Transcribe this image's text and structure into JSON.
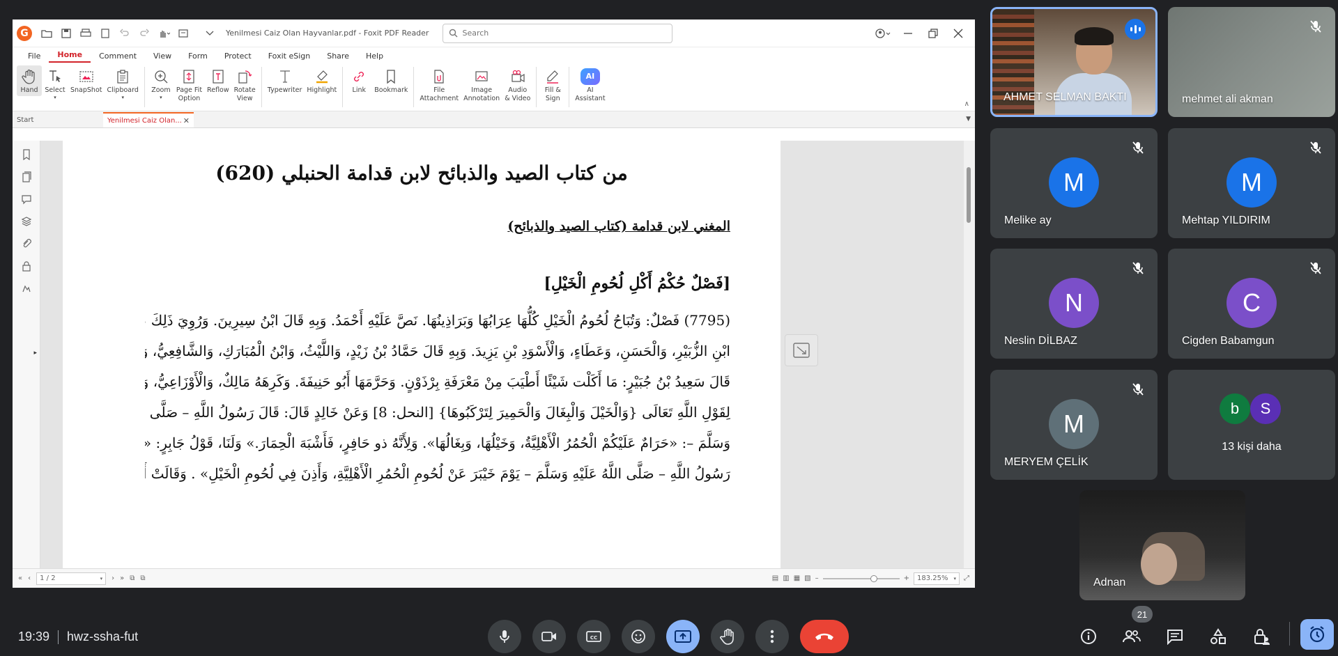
{
  "pdf": {
    "title": "Yenilmesi Caiz Olan Hayvanlar.pdf - Foxit PDF Reader",
    "search_placeholder": "Search",
    "menu": [
      "File",
      "Home",
      "Comment",
      "View",
      "Form",
      "Protect",
      "Foxit eSign",
      "Share",
      "Help"
    ],
    "ribbon": {
      "hand": "Hand",
      "select": "Select",
      "snapshot": "SnapShot",
      "clipboard": "Clipboard",
      "zoom": "Zoom",
      "pagefit_1": "Page Fit",
      "pagefit_2": "Option",
      "reflow": "Reflow",
      "rotate_1": "Rotate",
      "rotate_2": "View",
      "typewriter": "Typewriter",
      "highlight": "Highlight",
      "link": "Link",
      "bookmark": "Bookmark",
      "file_1": "File",
      "file_2": "Attachment",
      "image_1": "Image",
      "image_2": "Annotation",
      "audio_1": "Audio",
      "audio_2": "& Video",
      "fill_1": "Fill &",
      "fill_2": "Sign",
      "ai_1": "AI",
      "ai_2": "Assistant",
      "ai_icon": "AI"
    },
    "tabs": {
      "start": "Start",
      "doc": "Yenilmesi Caiz Olan..."
    },
    "page": {
      "title": "من كتاب الصيد والذبائح لابن قدامة الحنبلي (620)",
      "subtitle": "المغني لابن قدامة (كتاب الصيد والذبائح)",
      "heading": "[فَصْلٌ حُكْمُ أَكْلِ لُحُومِ الْخَيْلِ]",
      "lines": [
        "(7795) فَصْلٌ: وَتُبَاحُ لُحُومُ الْخَيْلِ كُلُّهَا عِرَابُهَا وَبَرَاذِينُهَا. نَصَّ عَلَيْهِ أَحْمَدُ. وَبِهِ قَالَ ابْنُ سِيرِينَ. وَرُوِيَ ذَلِكَ عَنْ",
        "ابْنِ الزُّبَيْرِ، وَالْحَسَنِ، وَعَطَاءٍ، وَالْأَسْوَدِ بْنِ يَزِيدَ. وَبِهِ قَالَ حَمَّادُ بْنُ زَيْدٍ، وَاللَّيْثُ، وَابْنُ الْمُبَارَكِ، وَالشَّافِعِيُّ، وَأَبُو ثَوْرٍ.",
        "قَالَ سَعِيدُ بْنُ جُبَيْرٍ: مَا أَكَلْت شَيْئًا أَطْيَبَ مِنْ مَعْرَفَةِ بِرْذَوْنٍ. وَحَرَّمَهَا أَبُو حَنِيفَةَ. وَكَرِهَهُ مَالِكٌ، وَالْأَوْزَاعِيُّ، وَأَبُو عُبَيْدٍ؛",
        "لِقَوْلِ اللَّهِ تَعَالَى {وَالْخَيْلَ وَالْبِغَالَ وَالْحَمِيرَ لِتَرْكَبُوهَا} [النحل: 8] وَعَنْ خَالِدٍ قَالَ: قَالَ رَسُولُ اللَّهِ – صَلَّى اللَّهُ عَلَيْهِ",
        "وَسَلَّمَ –: «حَرَامٌ عَلَيْكُمْ الْحُمُرُ الْأَهْلِيَّةُ، وَخَيْلُهَا، وَبِغَالُهَا». وَلِأَنَّهُ ذو حَافِرٍ، فَأَشْبَهَ الْحِمَارَ.» وَلَنَا، قَوْلُ جَابِرٍ: «نَهَى",
        "رَسُولُ اللَّهِ – صَلَّى اللَّهُ عَلَيْهِ وَسَلَّمَ – يَوْمَ خَيْبَرَ عَنْ لُحُومِ الْحُمُرِ الْأَهْلِيَّةِ، وَأَذِنَ فِي لُحُومِ الْخَيْلِ» . وَقَالَتْ أَسْمَاءُ:"
      ]
    },
    "status": {
      "page": "1 / 2",
      "zoom": "183.25%"
    }
  },
  "participants": [
    {
      "name": "AHMET SELMAN BAKTI",
      "speaking": true
    },
    {
      "name": "mehmet ali akman",
      "muted": true
    },
    {
      "name": "Melike ay",
      "initial": "M",
      "color": "#1a73e8",
      "muted": true
    },
    {
      "name": "Mehtap YILDIRIM",
      "initial": "M",
      "color": "#1a73e8",
      "muted": true
    },
    {
      "name": "Neslin DİLBAZ",
      "initial": "N",
      "color": "#7b4fc9",
      "muted": true
    },
    {
      "name": "Cigden Babamgun",
      "initial": "C",
      "color": "#7b4fc9",
      "muted": true
    },
    {
      "name": "MERYEM ÇELİK",
      "initial": "M",
      "color": "#5f7078",
      "muted": true
    }
  ],
  "others": {
    "label": "13 kişi daha",
    "avatars": [
      {
        "initial": "b",
        "color": "#0f7b3f"
      },
      {
        "initial": "S",
        "color": "#5a2fb5"
      }
    ]
  },
  "self": {
    "name": "Adnan"
  },
  "meeting": {
    "time": "19:39",
    "code": "hwz-ssha-fut",
    "people_count": "21"
  },
  "colors": {
    "background": "#202124",
    "tile": "#3c4043",
    "end_call": "#ea4335",
    "active_control": "#8ab4f8",
    "foxit_accent": "#d2232a"
  }
}
